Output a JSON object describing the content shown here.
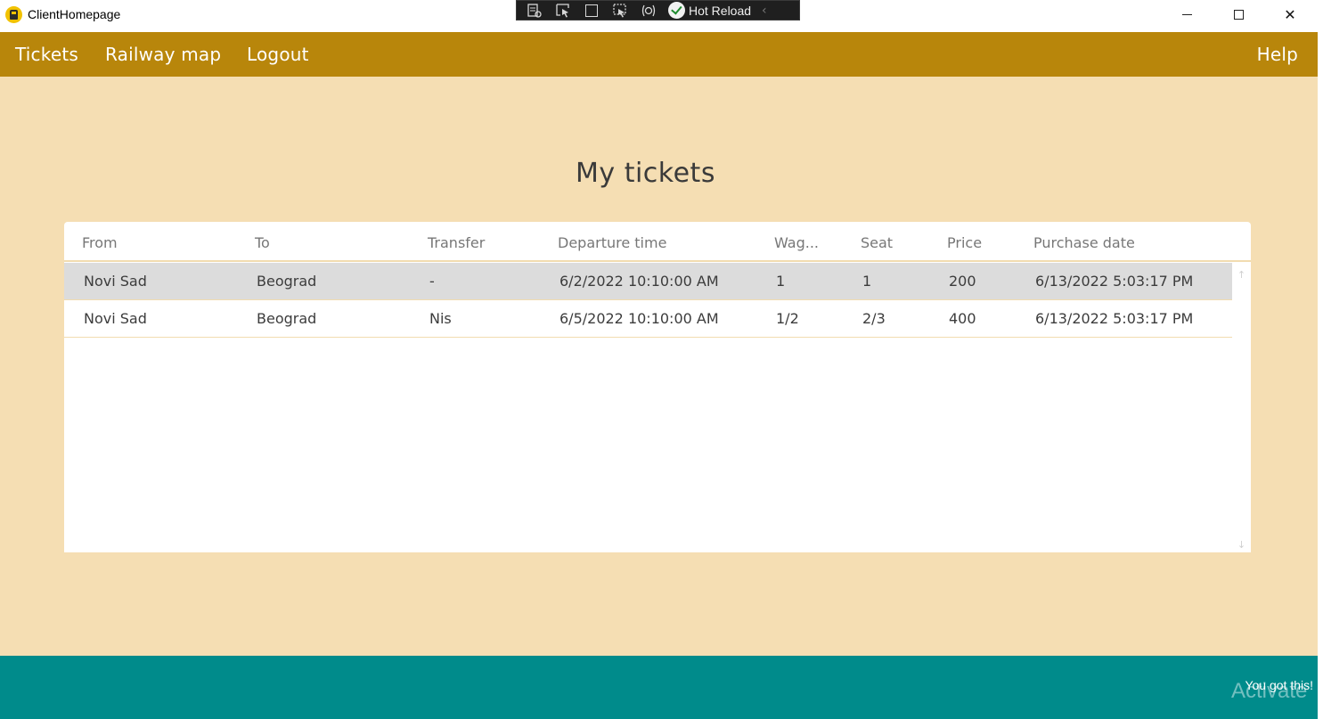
{
  "window": {
    "title": "ClientHomepage",
    "minimize_glyph": "",
    "close_glyph": "✕"
  },
  "debug_toolbar": {
    "hot_reload_label": "Hot Reload",
    "collapse_glyph": "‹"
  },
  "nav": {
    "tickets": "Tickets",
    "railway_map": "Railway map",
    "logout": "Logout",
    "help": "Help"
  },
  "page": {
    "title": "My tickets"
  },
  "table": {
    "columns": [
      "From",
      "To",
      "Transfer",
      "Departure time",
      "Wag...",
      "Seat",
      "Price",
      "Purchase date"
    ],
    "rows": [
      {
        "from": "Novi Sad",
        "to": "Beograd",
        "transfer": "-",
        "departure": "6/2/2022 10:10:00 AM",
        "wagon": "1",
        "seat": "1",
        "price": "200",
        "purchase": "6/13/2022 5:03:17 PM",
        "selected": true
      },
      {
        "from": "Novi Sad",
        "to": "Beograd",
        "transfer": "Nis",
        "departure": "6/5/2022 10:10:00 AM",
        "wagon": "1/2",
        "seat": "2/3",
        "price": "400",
        "purchase": "6/13/2022 5:03:17 PM",
        "selected": false
      }
    ]
  },
  "footer": {
    "text": "You got this!",
    "watermark": "Activate"
  },
  "colors": {
    "navbar": "#b8860b",
    "background": "#f5deb3",
    "footer": "#008b8b",
    "selected_row": "#dcdcdc"
  }
}
